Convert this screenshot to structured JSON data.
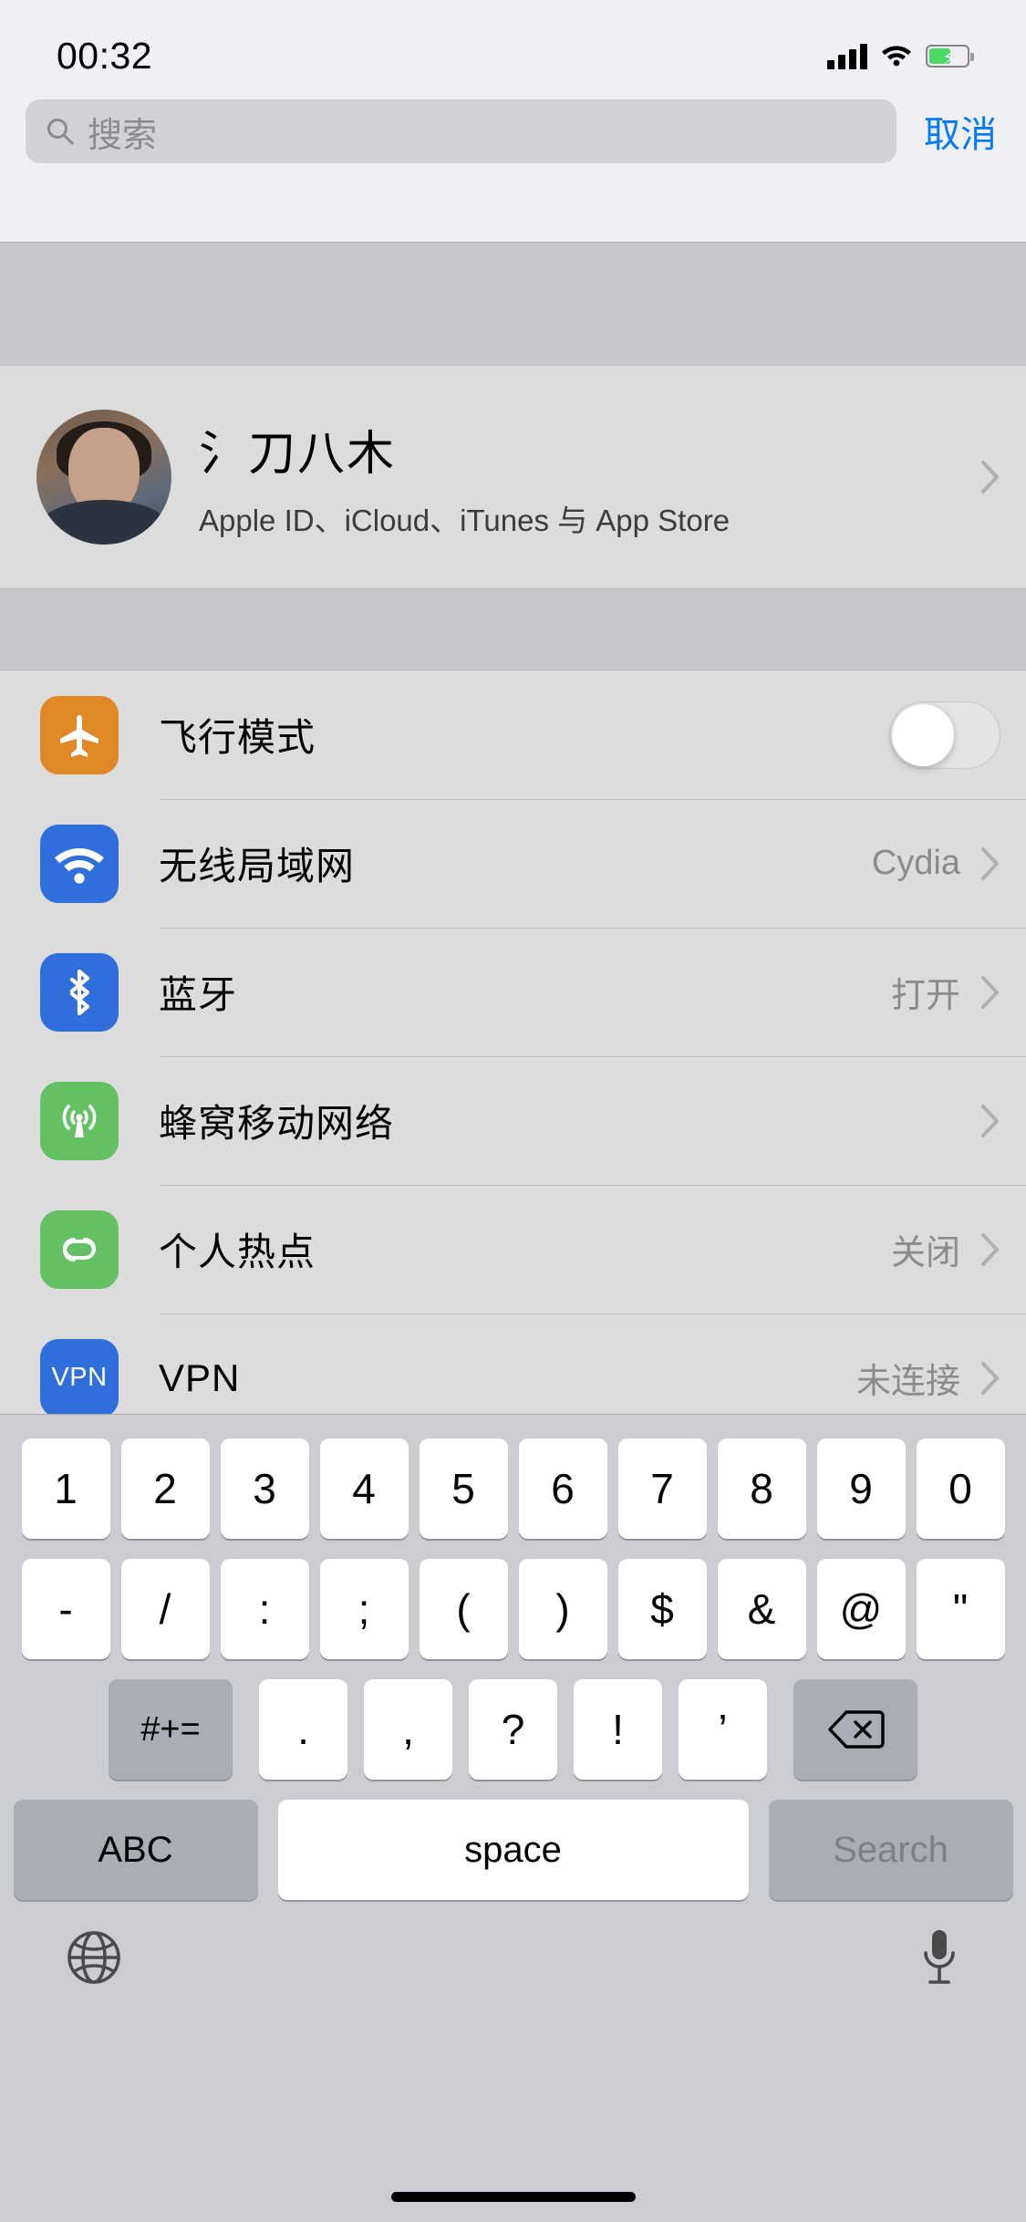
{
  "status_bar": {
    "time": "00:32",
    "signal_icon": "cellular-bars-icon",
    "wifi_icon": "wifi-icon",
    "battery_icon": "battery-charging-icon",
    "battery_color": "#4cd964"
  },
  "search": {
    "placeholder": "搜索",
    "value": "",
    "cancel_label": "取消",
    "icon": "search-icon"
  },
  "profile": {
    "name": "氵刀八木",
    "subtitle": "Apple ID、iCloud、iTunes 与 App Store",
    "avatar": "user-avatar",
    "chevron": "chevron-right-icon"
  },
  "settings": {
    "rows": [
      {
        "label": "飞行模式",
        "icon": "airplane-icon",
        "icon_color": "#e08828",
        "control": "toggle",
        "toggle_on": false,
        "value": ""
      },
      {
        "label": "无线局域网",
        "icon": "wifi-icon",
        "icon_color": "#2f6fdb",
        "control": "chevron",
        "value": "Cydia"
      },
      {
        "label": "蓝牙",
        "icon": "bluetooth-icon",
        "icon_color": "#2f6fdb",
        "control": "chevron",
        "value": "打开"
      },
      {
        "label": "蜂窝移动网络",
        "icon": "cellular-antenna-icon",
        "icon_color": "#63c163",
        "control": "chevron",
        "value": ""
      },
      {
        "label": "个人热点",
        "icon": "personal-hotspot-icon",
        "icon_color": "#63c163",
        "control": "chevron",
        "value": "关闭"
      },
      {
        "label": "VPN",
        "icon": "vpn-icon",
        "icon_color": "#2f6fdb",
        "icon_text": "VPN",
        "control": "chevron",
        "value": "未连接"
      }
    ]
  },
  "keyboard": {
    "row_numbers": [
      "1",
      "2",
      "3",
      "4",
      "5",
      "6",
      "7",
      "8",
      "9",
      "0"
    ],
    "row_symbols": [
      "-",
      "/",
      ":",
      ";",
      "(",
      ")",
      "$",
      "&",
      "@",
      "\""
    ],
    "row_punct": [
      ".",
      ",",
      "?",
      "!",
      "’"
    ],
    "shift_label": "#+=",
    "backspace_icon": "backspace-icon",
    "abc_label": "ABC",
    "space_label": "space",
    "return_label": "Search",
    "globe_icon": "globe-icon",
    "mic_icon": "microphone-icon"
  }
}
